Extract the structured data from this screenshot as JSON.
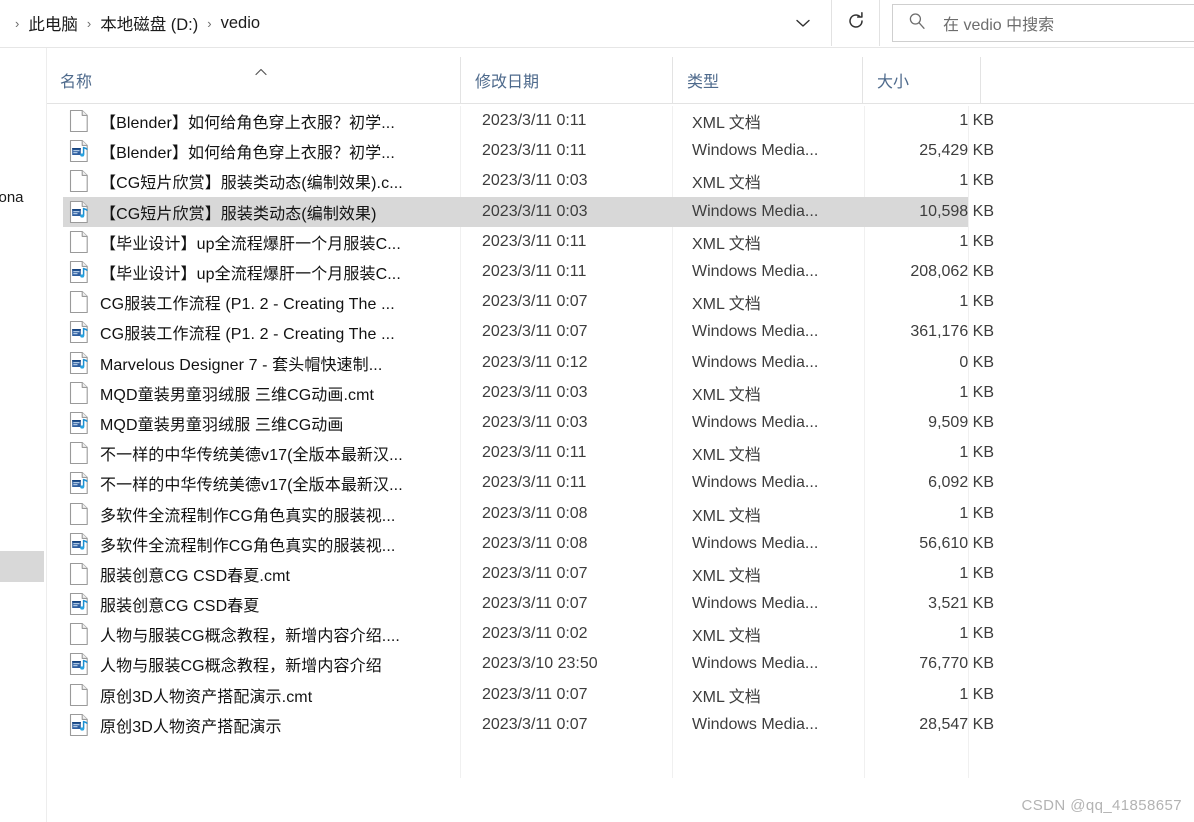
{
  "window": {
    "title": "vedio"
  },
  "address_bar": {
    "breadcrumb": [
      {
        "label": "此电脑"
      },
      {
        "label": "本地磁盘 (D:)"
      },
      {
        "label": "vedio"
      }
    ],
    "separator": "›",
    "dropdown_icon": "chevron-down-icon",
    "refresh_icon": "refresh-icon",
    "search": {
      "icon": "search-icon",
      "placeholder": "在 vedio 中搜索",
      "value": ""
    }
  },
  "columns": {
    "name": "名称",
    "date": "修改日期",
    "type": "类型",
    "size": "大小",
    "sort": {
      "column": "名称",
      "direction": "asc",
      "icon": "caret-up-icon"
    }
  },
  "left_pane": {
    "clipped_label": "rsona",
    "selected_item_color": "#d8d8d8"
  },
  "colors": {
    "selection": "#d8d8d8",
    "header_text": "#4e6a8c",
    "grid": "#e3e3e3",
    "watermark": "#b3b3b3"
  },
  "icons": {
    "xml": "xml-document-icon",
    "wmv": "windows-media-file-icon"
  },
  "files": [
    {
      "icon": "xml",
      "name": "【Blender】如何给角色穿上衣服？初学...",
      "date": "2023/3/11 0:11",
      "type": "XML 文档",
      "size": "1 KB",
      "selected": false
    },
    {
      "icon": "wmv",
      "name": "【Blender】如何给角色穿上衣服？初学...",
      "date": "2023/3/11 0:11",
      "type": "Windows Media...",
      "size": "25,429 KB",
      "selected": false
    },
    {
      "icon": "xml",
      "name": "【CG短片欣赏】服装类动态(编制效果).c...",
      "date": "2023/3/11 0:03",
      "type": "XML 文档",
      "size": "1 KB",
      "selected": false
    },
    {
      "icon": "wmv",
      "name": "【CG短片欣赏】服装类动态(编制效果)",
      "date": "2023/3/11 0:03",
      "type": "Windows Media...",
      "size": "10,598 KB",
      "selected": true
    },
    {
      "icon": "xml",
      "name": "【毕业设计】up全流程爆肝一个月服装C...",
      "date": "2023/3/11 0:11",
      "type": "XML 文档",
      "size": "1 KB",
      "selected": false
    },
    {
      "icon": "wmv",
      "name": "【毕业设计】up全流程爆肝一个月服装C...",
      "date": "2023/3/11 0:11",
      "type": "Windows Media...",
      "size": "208,062 KB",
      "selected": false
    },
    {
      "icon": "xml",
      "name": "CG服装工作流程 (P1. 2 - Creating The ...",
      "date": "2023/3/11 0:07",
      "type": "XML 文档",
      "size": "1 KB",
      "selected": false
    },
    {
      "icon": "wmv",
      "name": "CG服装工作流程 (P1. 2 - Creating The ...",
      "date": "2023/3/11 0:07",
      "type": "Windows Media...",
      "size": "361,176 KB",
      "selected": false
    },
    {
      "icon": "wmv",
      "name": "Marvelous Designer 7 - 套头帽快速制...",
      "date": "2023/3/11 0:12",
      "type": "Windows Media...",
      "size": "0 KB",
      "selected": false
    },
    {
      "icon": "xml",
      "name": "MQD童装男童羽绒服 三维CG动画.cmt",
      "date": "2023/3/11 0:03",
      "type": "XML 文档",
      "size": "1 KB",
      "selected": false
    },
    {
      "icon": "wmv",
      "name": "MQD童装男童羽绒服 三维CG动画",
      "date": "2023/3/11 0:03",
      "type": "Windows Media...",
      "size": "9,509 KB",
      "selected": false
    },
    {
      "icon": "xml",
      "name": "不一样的中华传统美德v17(全版本最新汉...",
      "date": "2023/3/11 0:11",
      "type": "XML 文档",
      "size": "1 KB",
      "selected": false
    },
    {
      "icon": "wmv",
      "name": "不一样的中华传统美德v17(全版本最新汉...",
      "date": "2023/3/11 0:11",
      "type": "Windows Media...",
      "size": "6,092 KB",
      "selected": false
    },
    {
      "icon": "xml",
      "name": "多软件全流程制作CG角色真实的服装视...",
      "date": "2023/3/11 0:08",
      "type": "XML 文档",
      "size": "1 KB",
      "selected": false
    },
    {
      "icon": "wmv",
      "name": "多软件全流程制作CG角色真实的服装视...",
      "date": "2023/3/11 0:08",
      "type": "Windows Media...",
      "size": "56,610 KB",
      "selected": false
    },
    {
      "icon": "xml",
      "name": "服装创意CG CSD春夏.cmt",
      "date": "2023/3/11 0:07",
      "type": "XML 文档",
      "size": "1 KB",
      "selected": false
    },
    {
      "icon": "wmv",
      "name": "服装创意CG CSD春夏",
      "date": "2023/3/11 0:07",
      "type": "Windows Media...",
      "size": "3,521 KB",
      "selected": false
    },
    {
      "icon": "xml",
      "name": "人物与服装CG概念教程，新增内容介绍....",
      "date": "2023/3/11 0:02",
      "type": "XML 文档",
      "size": "1 KB",
      "selected": false
    },
    {
      "icon": "wmv",
      "name": "人物与服装CG概念教程，新增内容介绍",
      "date": "2023/3/10 23:50",
      "type": "Windows Media...",
      "size": "76,770 KB",
      "selected": false
    },
    {
      "icon": "xml",
      "name": "原创3D人物资产搭配演示.cmt",
      "date": "2023/3/11 0:07",
      "type": "XML 文档",
      "size": "1 KB",
      "selected": false
    },
    {
      "icon": "wmv",
      "name": "原创3D人物资产搭配演示",
      "date": "2023/3/11 0:07",
      "type": "Windows Media...",
      "size": "28,547 KB",
      "selected": false
    }
  ],
  "watermark": "CSDN @qq_41858657"
}
